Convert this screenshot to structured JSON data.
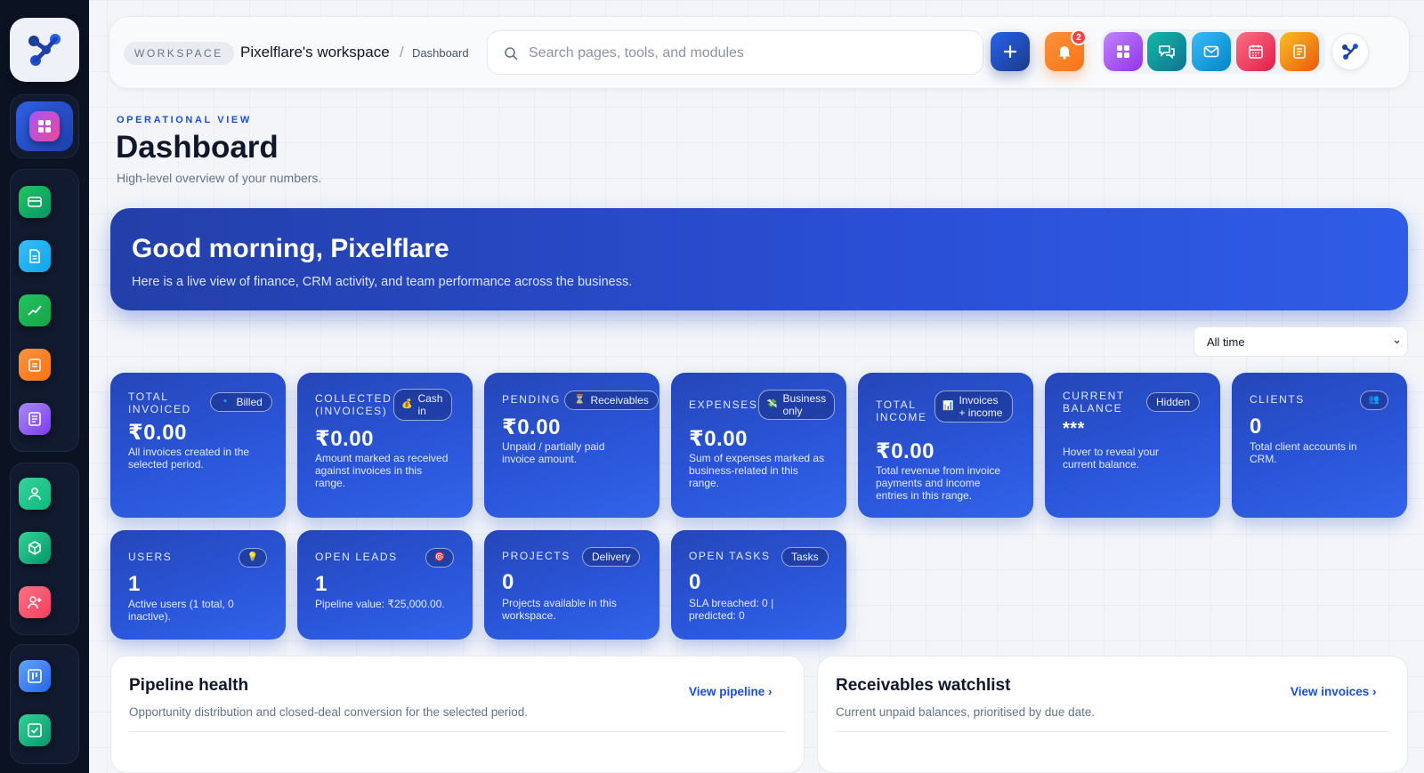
{
  "topbar": {
    "workspace_pill": "WORKSPACE",
    "workspace_name": "Pixelflare's workspace",
    "separator": "/",
    "crumb": "Dashboard",
    "search_placeholder": "Search pages, tools, and modules",
    "notification_count": "2"
  },
  "header": {
    "eyebrow": "OPERATIONAL VIEW",
    "title": "Dashboard",
    "subtitle": "High-level overview of your numbers."
  },
  "hero": {
    "greeting": "Good morning, Pixelflare",
    "subtitle": "Here is a live view of finance, CRM activity, and team performance across the business."
  },
  "range": {
    "selected": "All time",
    "chevron": "⌄"
  },
  "kpis": [
    {
      "label": "TOTAL INVOICED",
      "tag": "Billed",
      "tag_icon": "🔹",
      "value": "₹0.00",
      "desc": "All invoices created in the selected period."
    },
    {
      "label": "COLLECTED (INVOICES)",
      "tag": "Cash in",
      "tag_icon": "💰",
      "value": "₹0.00",
      "desc": "Amount marked as received against invoices in this range."
    },
    {
      "label": "PENDING",
      "tag": "Receivables",
      "tag_icon": "⏳",
      "value": "₹0.00",
      "desc": "Unpaid / partially paid invoice amount."
    },
    {
      "label": "EXPENSES",
      "tag": "Business only",
      "tag_icon": "💸",
      "value": "₹0.00",
      "desc": "Sum of expenses marked as business-related in this range."
    },
    {
      "label": "TOTAL INCOME",
      "tag": "Invoices + income",
      "tag_icon": "📊",
      "value": "₹0.00",
      "desc": "Total revenue from invoice payments and income entries in this range."
    },
    {
      "label": "CURRENT BALANCE",
      "tag": "Hidden",
      "tag_icon": "",
      "value": "***",
      "desc": "Hover to reveal your current balance."
    },
    {
      "label": "CLIENTS",
      "tag": "",
      "tag_icon": "👥",
      "value": "0",
      "desc": "Total client accounts in CRM."
    },
    {
      "label": "USERS",
      "tag": "",
      "tag_icon": "💡",
      "value": "1",
      "desc": "Active users (1 total, 0 inactive)."
    },
    {
      "label": "OPEN LEADS",
      "tag": "",
      "tag_icon": "🎯",
      "value": "1",
      "desc": "Pipeline value: ₹25,000.00."
    },
    {
      "label": "PROJECTS",
      "tag": "Delivery",
      "tag_icon": "",
      "value": "0",
      "desc": "Projects available in this workspace."
    },
    {
      "label": "OPEN TASKS",
      "tag": "Tasks",
      "tag_icon": "",
      "value": "0",
      "desc": "SLA breached: 0 | predicted: 0"
    }
  ],
  "panels": {
    "pipeline": {
      "title": "Pipeline health",
      "subtitle": "Opportunity distribution and closed-deal conversion for the selected period.",
      "link": "View pipeline  ›"
    },
    "receivables": {
      "title": "Receivables watchlist",
      "subtitle": "Current unpaid balances, prioritised by due date.",
      "link": "View invoices  ›"
    }
  },
  "icons": {
    "sidebar": [
      "dashboard-icon",
      "wallet-icon",
      "document-icon",
      "chart-line-icon",
      "clipboard-icon",
      "notes-icon",
      "user-icon",
      "package-icon",
      "user-add-icon",
      "kanban-icon",
      "task-check-icon"
    ],
    "top": [
      "plus-icon",
      "bell-icon",
      "apps-icon",
      "chat-icon",
      "mail-icon",
      "calendar-icon",
      "notes-icon"
    ]
  },
  "colors": {
    "accent": "#2a55d8",
    "sidebar_bg": "#0b1222",
    "link": "#1d4ed8",
    "badge": "#ef4444"
  }
}
